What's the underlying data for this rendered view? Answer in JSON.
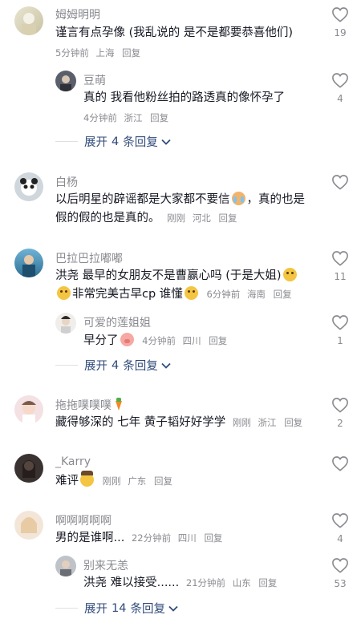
{
  "comments": [
    {
      "name": "姆姆明明",
      "text": "谨言有点孕像 (我乱说的 是不是都要恭喜他们)",
      "time": "5分钟前",
      "location": "上海",
      "reply_label": "回复",
      "likes": "19",
      "replies": [
        {
          "name": "豆萌",
          "text": "真的 我看他粉丝拍的路透真的像怀孕了",
          "time": "4分钟前",
          "location": "浙江",
          "reply_label": "回复",
          "likes": "4"
        }
      ],
      "expand": {
        "prefix": "展开",
        "count": "4",
        "suffix": "条回复"
      }
    },
    {
      "name": "白杨",
      "text_line1": "以后明星的辟谣都是大家都不要信",
      "text_line1b": "，真的也是",
      "text_line2": "假的假的也是真的。",
      "time": "刚刚",
      "location": "河北",
      "reply_label": "回复",
      "likes": ""
    },
    {
      "name": "巴拉巴拉嘟嘟",
      "text_line1": "洪尧 最早的女朋友不是曹赢心吗 (于是大姐)",
      "text_line2": "非常完美古早cp 谁懂",
      "time": "6分钟前",
      "location": "海南",
      "reply_label": "回复",
      "likes": "11",
      "replies": [
        {
          "name": "可爱的莲姐姐",
          "text": "早分了",
          "time": "4分钟前",
          "location": "四川",
          "reply_label": "回复",
          "likes": "1"
        }
      ],
      "expand": {
        "prefix": "展开",
        "count": "4",
        "suffix": "条回复"
      }
    },
    {
      "name": "拖拖噗噗噗",
      "text": "藏得够深的 七年 黄子韬好好学学",
      "time": "刚刚",
      "location": "浙江",
      "reply_label": "回复",
      "likes": "2"
    },
    {
      "name": "_Karry",
      "text": "难评",
      "time": "刚刚",
      "location": "广东",
      "reply_label": "回复",
      "likes": ""
    },
    {
      "name": "啊啊啊啊啊",
      "text": "男的是谁啊...",
      "time": "22分钟前",
      "location": "四川",
      "reply_label": "回复",
      "likes": "4",
      "replies": [
        {
          "name": "别来无恙",
          "text": "洪尧 难以接受......",
          "time": "21分钟前",
          "location": "山东",
          "reply_label": "回复",
          "likes": "53"
        }
      ],
      "expand": {
        "prefix": "展开",
        "count": "14",
        "suffix": "条回复"
      }
    }
  ],
  "colors": {
    "name": "#8a8b91",
    "text": "#161823",
    "expand": "#2f4a7a"
  },
  "icons": {
    "like": "heart-outline-icon",
    "expand": "chevron-down-icon"
  }
}
